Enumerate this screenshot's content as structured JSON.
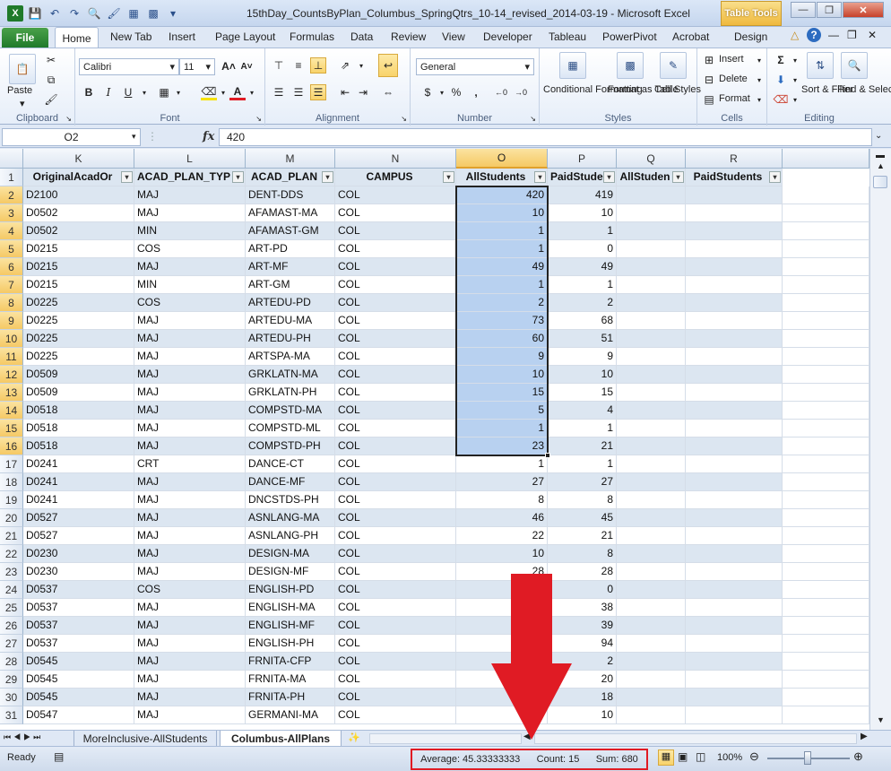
{
  "window": {
    "title": "15thDay_CountsByPlan_Columbus_SpringQtrs_10-14_revised_2014-03-19  -  Microsoft Excel",
    "table_tools": "Table Tools"
  },
  "ribbon_tabs": [
    "File",
    "Home",
    "New Tab",
    "Insert",
    "Page Layout",
    "Formulas",
    "Data",
    "Review",
    "View",
    "Developer",
    "Tableau",
    "PowerPivot",
    "Acrobat",
    "Design"
  ],
  "ribbon": {
    "clipboard": {
      "label": "Clipboard",
      "paste": "Paste"
    },
    "font": {
      "label": "Font",
      "name": "Calibri",
      "size": "11"
    },
    "alignment": {
      "label": "Alignment"
    },
    "number": {
      "label": "Number",
      "format": "General"
    },
    "styles": {
      "label": "Styles",
      "conditional": "Conditional Formatting",
      "format_table": "Format as Table",
      "cell_styles": "Cell Styles"
    },
    "cells": {
      "label": "Cells",
      "insert": "Insert",
      "delete": "Delete",
      "format": "Format"
    },
    "editing": {
      "label": "Editing",
      "sort": "Sort & Filter",
      "find": "Find & Select"
    }
  },
  "formula_bar": {
    "name_box": "O2",
    "fx": "fx",
    "value": "420"
  },
  "columns": [
    "K",
    "L",
    "M",
    "N",
    "O",
    "P",
    "Q",
    "R"
  ],
  "header_row": [
    "OriginalAcadOr",
    "ACAD_PLAN_TYP",
    "ACAD_PLAN",
    "CAMPUS",
    "AllStudents",
    "PaidStude",
    "AllStuden",
    "PaidStudents"
  ],
  "rows": [
    [
      "D2100",
      "MAJ",
      "DENT-DDS",
      "COL",
      "420",
      "419"
    ],
    [
      "D0502",
      "MAJ",
      "AFAMAST-MA",
      "COL",
      "10",
      "10"
    ],
    [
      "D0502",
      "MIN",
      "AFAMAST-GM",
      "COL",
      "1",
      "1"
    ],
    [
      "D0215",
      "COS",
      "ART-PD",
      "COL",
      "1",
      "0"
    ],
    [
      "D0215",
      "MAJ",
      "ART-MF",
      "COL",
      "49",
      "49"
    ],
    [
      "D0215",
      "MIN",
      "ART-GM",
      "COL",
      "1",
      "1"
    ],
    [
      "D0225",
      "COS",
      "ARTEDU-PD",
      "COL",
      "2",
      "2"
    ],
    [
      "D0225",
      "MAJ",
      "ARTEDU-MA",
      "COL",
      "73",
      "68"
    ],
    [
      "D0225",
      "MAJ",
      "ARTEDU-PH",
      "COL",
      "60",
      "51"
    ],
    [
      "D0225",
      "MAJ",
      "ARTSPA-MA",
      "COL",
      "9",
      "9"
    ],
    [
      "D0509",
      "MAJ",
      "GRKLATN-MA",
      "COL",
      "10",
      "10"
    ],
    [
      "D0509",
      "MAJ",
      "GRKLATN-PH",
      "COL",
      "15",
      "15"
    ],
    [
      "D0518",
      "MAJ",
      "COMPSTD-MA",
      "COL",
      "5",
      "4"
    ],
    [
      "D0518",
      "MAJ",
      "COMPSTD-ML",
      "COL",
      "1",
      "1"
    ],
    [
      "D0518",
      "MAJ",
      "COMPSTD-PH",
      "COL",
      "23",
      "21"
    ],
    [
      "D0241",
      "CRT",
      "DANCE-CT",
      "COL",
      "1",
      "1"
    ],
    [
      "D0241",
      "MAJ",
      "DANCE-MF",
      "COL",
      "27",
      "27"
    ],
    [
      "D0241",
      "MAJ",
      "DNCSTDS-PH",
      "COL",
      "8",
      "8"
    ],
    [
      "D0527",
      "MAJ",
      "ASNLANG-MA",
      "COL",
      "46",
      "45"
    ],
    [
      "D0527",
      "MAJ",
      "ASNLANG-PH",
      "COL",
      "22",
      "21"
    ],
    [
      "D0230",
      "MAJ",
      "DESIGN-MA",
      "COL",
      "10",
      "8"
    ],
    [
      "D0230",
      "MAJ",
      "DESIGN-MF",
      "COL",
      "28",
      "28"
    ],
    [
      "D0537",
      "COS",
      "ENGLISH-PD",
      "COL",
      "",
      "0"
    ],
    [
      "D0537",
      "MAJ",
      "ENGLISH-MA",
      "COL",
      "",
      "38"
    ],
    [
      "D0537",
      "MAJ",
      "ENGLISH-MF",
      "COL",
      "",
      "39"
    ],
    [
      "D0537",
      "MAJ",
      "ENGLISH-PH",
      "COL",
      "",
      "94"
    ],
    [
      "D0545",
      "MAJ",
      "FRNITA-CFP",
      "COL",
      "",
      "2"
    ],
    [
      "D0545",
      "MAJ",
      "FRNITA-MA",
      "COL",
      "",
      "20"
    ],
    [
      "D0545",
      "MAJ",
      "FRNITA-PH",
      "COL",
      "",
      "18"
    ],
    [
      "D0547",
      "MAJ",
      "GERMANI-MA",
      "COL",
      "",
      "10"
    ]
  ],
  "sheet_tabs": [
    "MoreInclusive-AllStudents",
    "Columbus-AllPlans"
  ],
  "status": {
    "ready": "Ready",
    "average": "Average: 45.33333333",
    "count": "Count: 15",
    "sum": "Sum: 680",
    "zoom": "100%"
  },
  "colors": {
    "accent_red": "#e01b24",
    "table_header": "#1f497d",
    "band": "#dce6f1"
  }
}
